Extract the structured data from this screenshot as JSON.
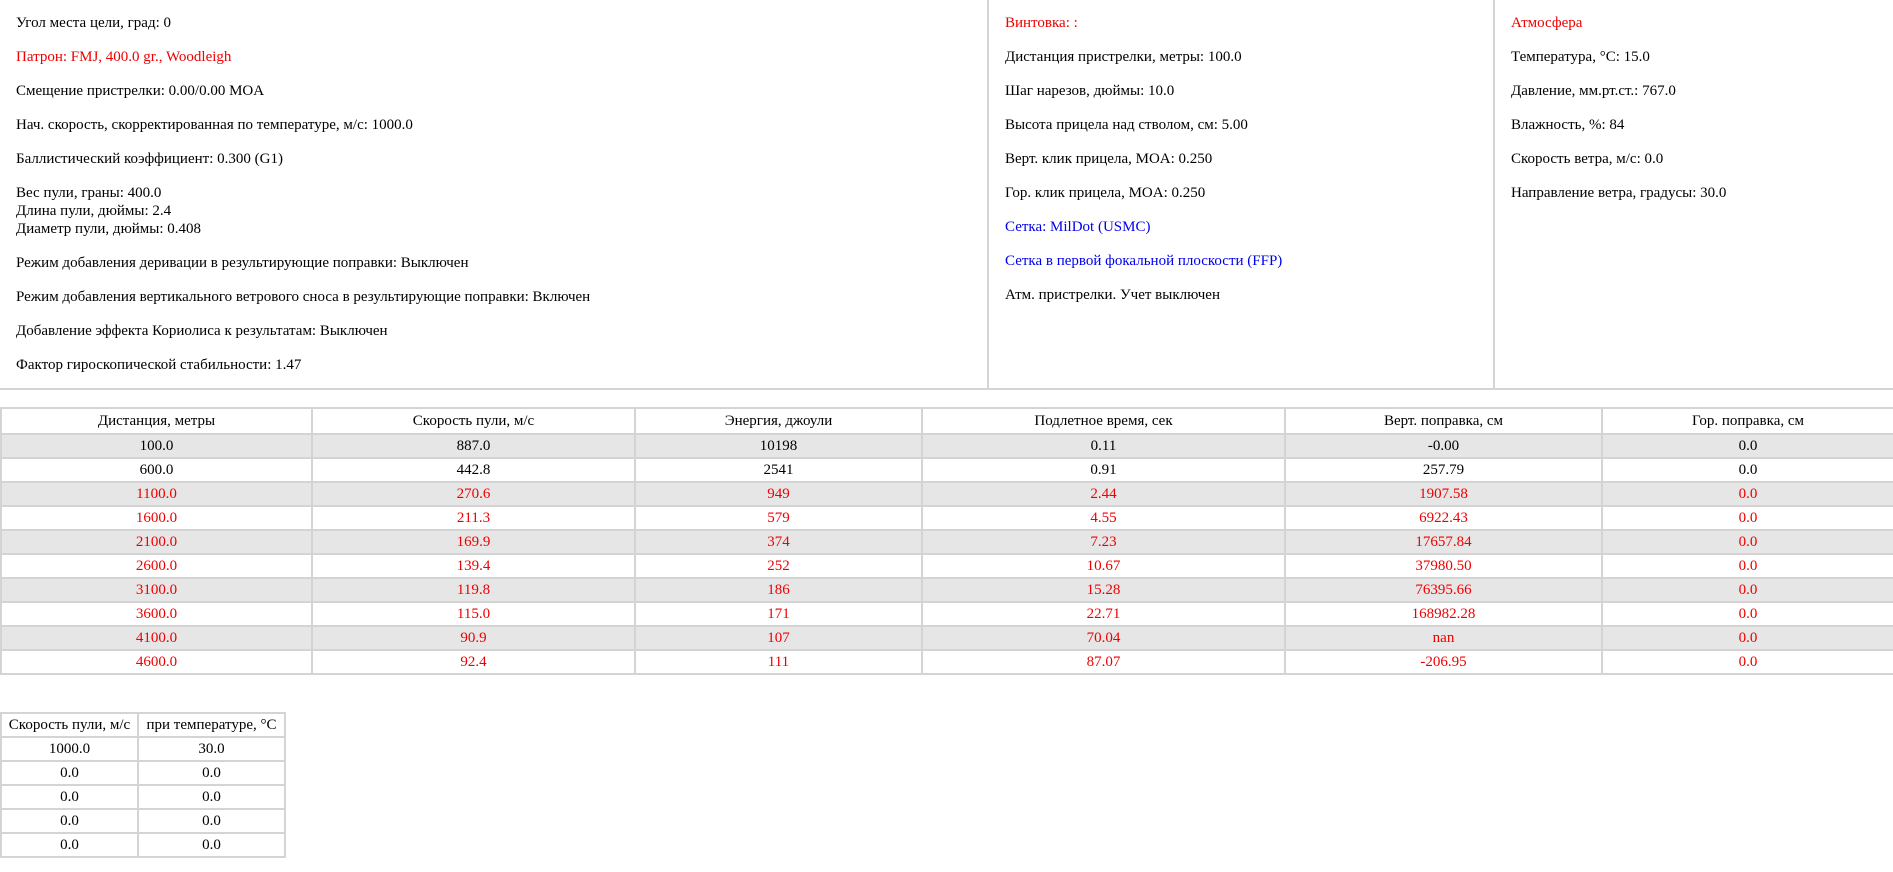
{
  "left_column": {
    "target_angle": "Угол места цели, град: 0",
    "cartridge": "Патрон: FMJ, 400.0 gr., Woodleigh",
    "zero_offset": "Смещение пристрелки: 0.00/0.00 MOA",
    "muzzle_velocity": "Нач. скорость, скорректированная по температуре, м/с: 1000.0",
    "ballistic_coefficient": "Баллистический коэффициент: 0.300 (G1)",
    "bullet_weight": "Вес пули, граны: 400.0",
    "bullet_length": "Длина пули, дюймы: 2.4",
    "bullet_diameter": "Диаметр пули, дюймы: 0.408",
    "spin_drift_mode": "Режим добавления деривации в результирующие поправки: Выключен",
    "vertical_wind_mode": "Режим добавления вертикального ветрового сноса в результирующие поправки: Включен",
    "coriolis_mode": "Добавление эффекта Кориолиса к результатам: Выключен",
    "gyro_stability": "Фактор гироскопической стабильности: 1.47"
  },
  "middle_column": {
    "rifle": "Винтовка: :",
    "zero_distance": "Дистанция пристрелки, метры: 100.0",
    "twist": "Шаг нарезов, дюймы: 10.0",
    "sight_height": "Высота прицела над стволом, см: 5.00",
    "vert_click": "Верт. клик прицела, MOA: 0.250",
    "horiz_click": "Гор. клик прицела, MOA: 0.250",
    "reticle": "Сетка: MilDot (USMC)",
    "ffp": "Сетка в первой фокальной плоскости (FFP)",
    "zero_atmosphere": "Атм. пристрелки. Учет выключен"
  },
  "right_column": {
    "atmosphere_title": "Атмосфера",
    "temperature": "Температура, °C: 15.0",
    "pressure": "Давление, мм.рт.ст.: 767.0",
    "humidity": "Влажность, %: 84",
    "wind_speed": "Скорость ветра, м/с: 0.0",
    "wind_direction": "Направление ветра, градусы: 30.0"
  },
  "results_table": {
    "headers": [
      "Дистанция, метры",
      "Скорость пули, м/с",
      "Энергия, джоули",
      "Подлетное время, сек",
      "Верт. поправка, см",
      "Гор. поправка, см"
    ],
    "rows": [
      [
        "100.0",
        "887.0",
        "10198",
        "0.11",
        "-0.00",
        "0.0"
      ],
      [
        "600.0",
        "442.8",
        "2541",
        "0.91",
        "257.79",
        "0.0"
      ],
      [
        "1100.0",
        "270.6",
        "949",
        "2.44",
        "1907.58",
        "0.0"
      ],
      [
        "1600.0",
        "211.3",
        "579",
        "4.55",
        "6922.43",
        "0.0"
      ],
      [
        "2100.0",
        "169.9",
        "374",
        "7.23",
        "17657.84",
        "0.0"
      ],
      [
        "2600.0",
        "139.4",
        "252",
        "10.67",
        "37980.50",
        "0.0"
      ],
      [
        "3100.0",
        "119.8",
        "186",
        "15.28",
        "76395.66",
        "0.0"
      ],
      [
        "3600.0",
        "115.0",
        "171",
        "22.71",
        "168982.28",
        "0.0"
      ],
      [
        "4100.0",
        "90.9",
        "107",
        "70.04",
        "nan",
        "0.0"
      ],
      [
        "4600.0",
        "92.4",
        "111",
        "87.07",
        "-206.95",
        "0.0"
      ]
    ]
  },
  "temperature_table": {
    "headers": [
      "Скорость пули, м/с",
      "при температуре, °C"
    ],
    "rows": [
      [
        "1000.0",
        "30.0"
      ],
      [
        "0.0",
        "0.0"
      ],
      [
        "0.0",
        "0.0"
      ],
      [
        "0.0",
        "0.0"
      ],
      [
        "0.0",
        "0.0"
      ]
    ]
  },
  "colors": {
    "warning": "#ee0000",
    "link": "#0000ee",
    "row_stripe": "#e6e6e6",
    "border": "#d4d4d4"
  }
}
